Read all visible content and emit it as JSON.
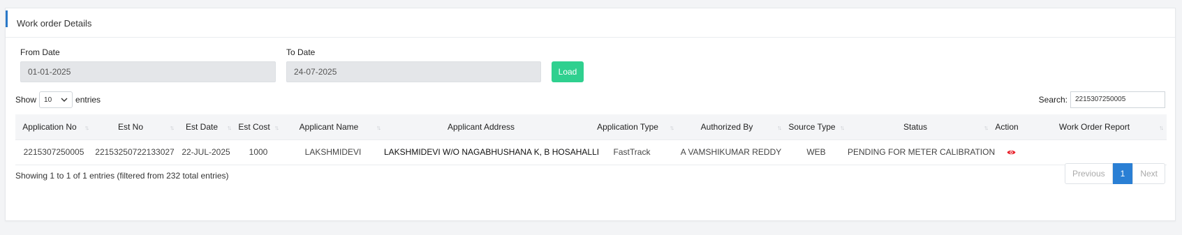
{
  "header": {
    "title": "Work order Details"
  },
  "filters": {
    "from_label": "From Date",
    "from_value": "01-01-2025",
    "to_label": "To Date",
    "to_value": "24-07-2025",
    "load_label": "Load"
  },
  "length": {
    "show_label": "Show",
    "value": "10",
    "entries_label": "entries"
  },
  "search": {
    "label": "Search:",
    "value": "2215307250005"
  },
  "table": {
    "columns": [
      "Application No",
      "Est No",
      "Est Date",
      "Est Cost",
      "Applicant Name",
      "Applicant Address",
      "Application Type",
      "Authorized By",
      "Source Type",
      "Status",
      "Action",
      "Work Order Report"
    ],
    "rows": [
      {
        "application_no": "2215307250005",
        "est_no": "22153250722133027",
        "est_date": "22-JUL-2025",
        "est_cost": "1000",
        "applicant_name": "LAKSHMIDEVI",
        "applicant_address": "LAKSHMIDEVI W/O NAGABHUSHANA K, B HOSAHALLI",
        "application_type": "FastTrack",
        "authorized_by": "A VAMSHIKUMAR REDDY",
        "source_type": "WEB",
        "status": "PENDING FOR METER CALIBRATION",
        "action_icon": "eye-icon",
        "work_order_report": ""
      }
    ]
  },
  "footer": {
    "info": "Showing 1 to 1 of 1 entries (filtered from 232 total entries)",
    "previous_label": "Previous",
    "current_page": "1",
    "next_label": "Next"
  },
  "colors": {
    "accent": "#2a78c8",
    "load_button": "#2fd08f",
    "active_page": "#2a7fd4",
    "action_icon": "#e8202a"
  }
}
